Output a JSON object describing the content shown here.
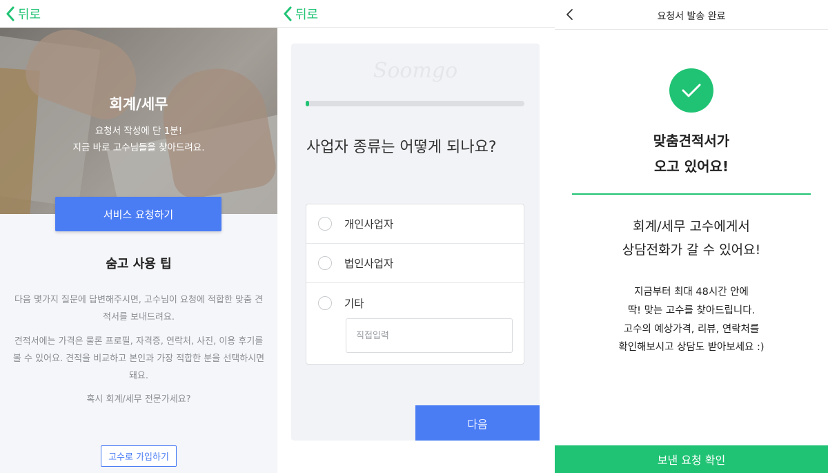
{
  "screen1": {
    "back_label": "뒤로",
    "hero": {
      "title": "회계/세무",
      "subtitle_line1": "요청서 작성에 단 1분!",
      "subtitle_line2": "지금 바로 고수님들을 찾아드려요."
    },
    "request_button": "서비스 요청하기",
    "tips_title": "숨고 사용 팁",
    "tips": [
      "다음 몇가지 질문에 답변해주시면, 고수님이 요청에 적합한 맞춤 견적서를 보내드려요.",
      "견적서에는 가격은 물론 프로필, 자격증, 연락처, 사진, 이용 후기를 볼 수 있어요. 견적을 비교하고 본인과 가장 적합한 분을 선택하시면 돼요.",
      "혹시 회계/세무 전문가세요?"
    ],
    "join_button": "고수로 가입하기"
  },
  "screen2": {
    "back_label": "뒤로",
    "logo": "Soomgo",
    "progress": 0.01,
    "question": "사업자 종류는 어떻게 되나요?",
    "options": [
      "개인사업자",
      "법인사업자",
      "기타"
    ],
    "other_input_placeholder": "직접입력",
    "next_button": "다음"
  },
  "screen3": {
    "nav_title": "요청서 발송 완료",
    "headline_line1": "맞춤견적서가",
    "headline_line2": "오고 있어요!",
    "callout_line1": "회계/세무 고수에게서",
    "callout_line2": "상담전화가 갈 수 있어요!",
    "info_lines": [
      "지금부터 최대 48시간 안에",
      "딱! 맞는 고수를 찾아드립니다.",
      "고수의 예상가격, 리뷰, 연락처를",
      "확인해보시고 상담도 받아보세요 :)"
    ],
    "confirm_button": "보낸 요청 확인"
  },
  "colors": {
    "brand_green": "#20c374",
    "primary_blue": "#4a7cf4"
  },
  "icons": {
    "back": "chevron-left-icon",
    "success": "check-icon",
    "radio": "radio-empty-icon"
  }
}
